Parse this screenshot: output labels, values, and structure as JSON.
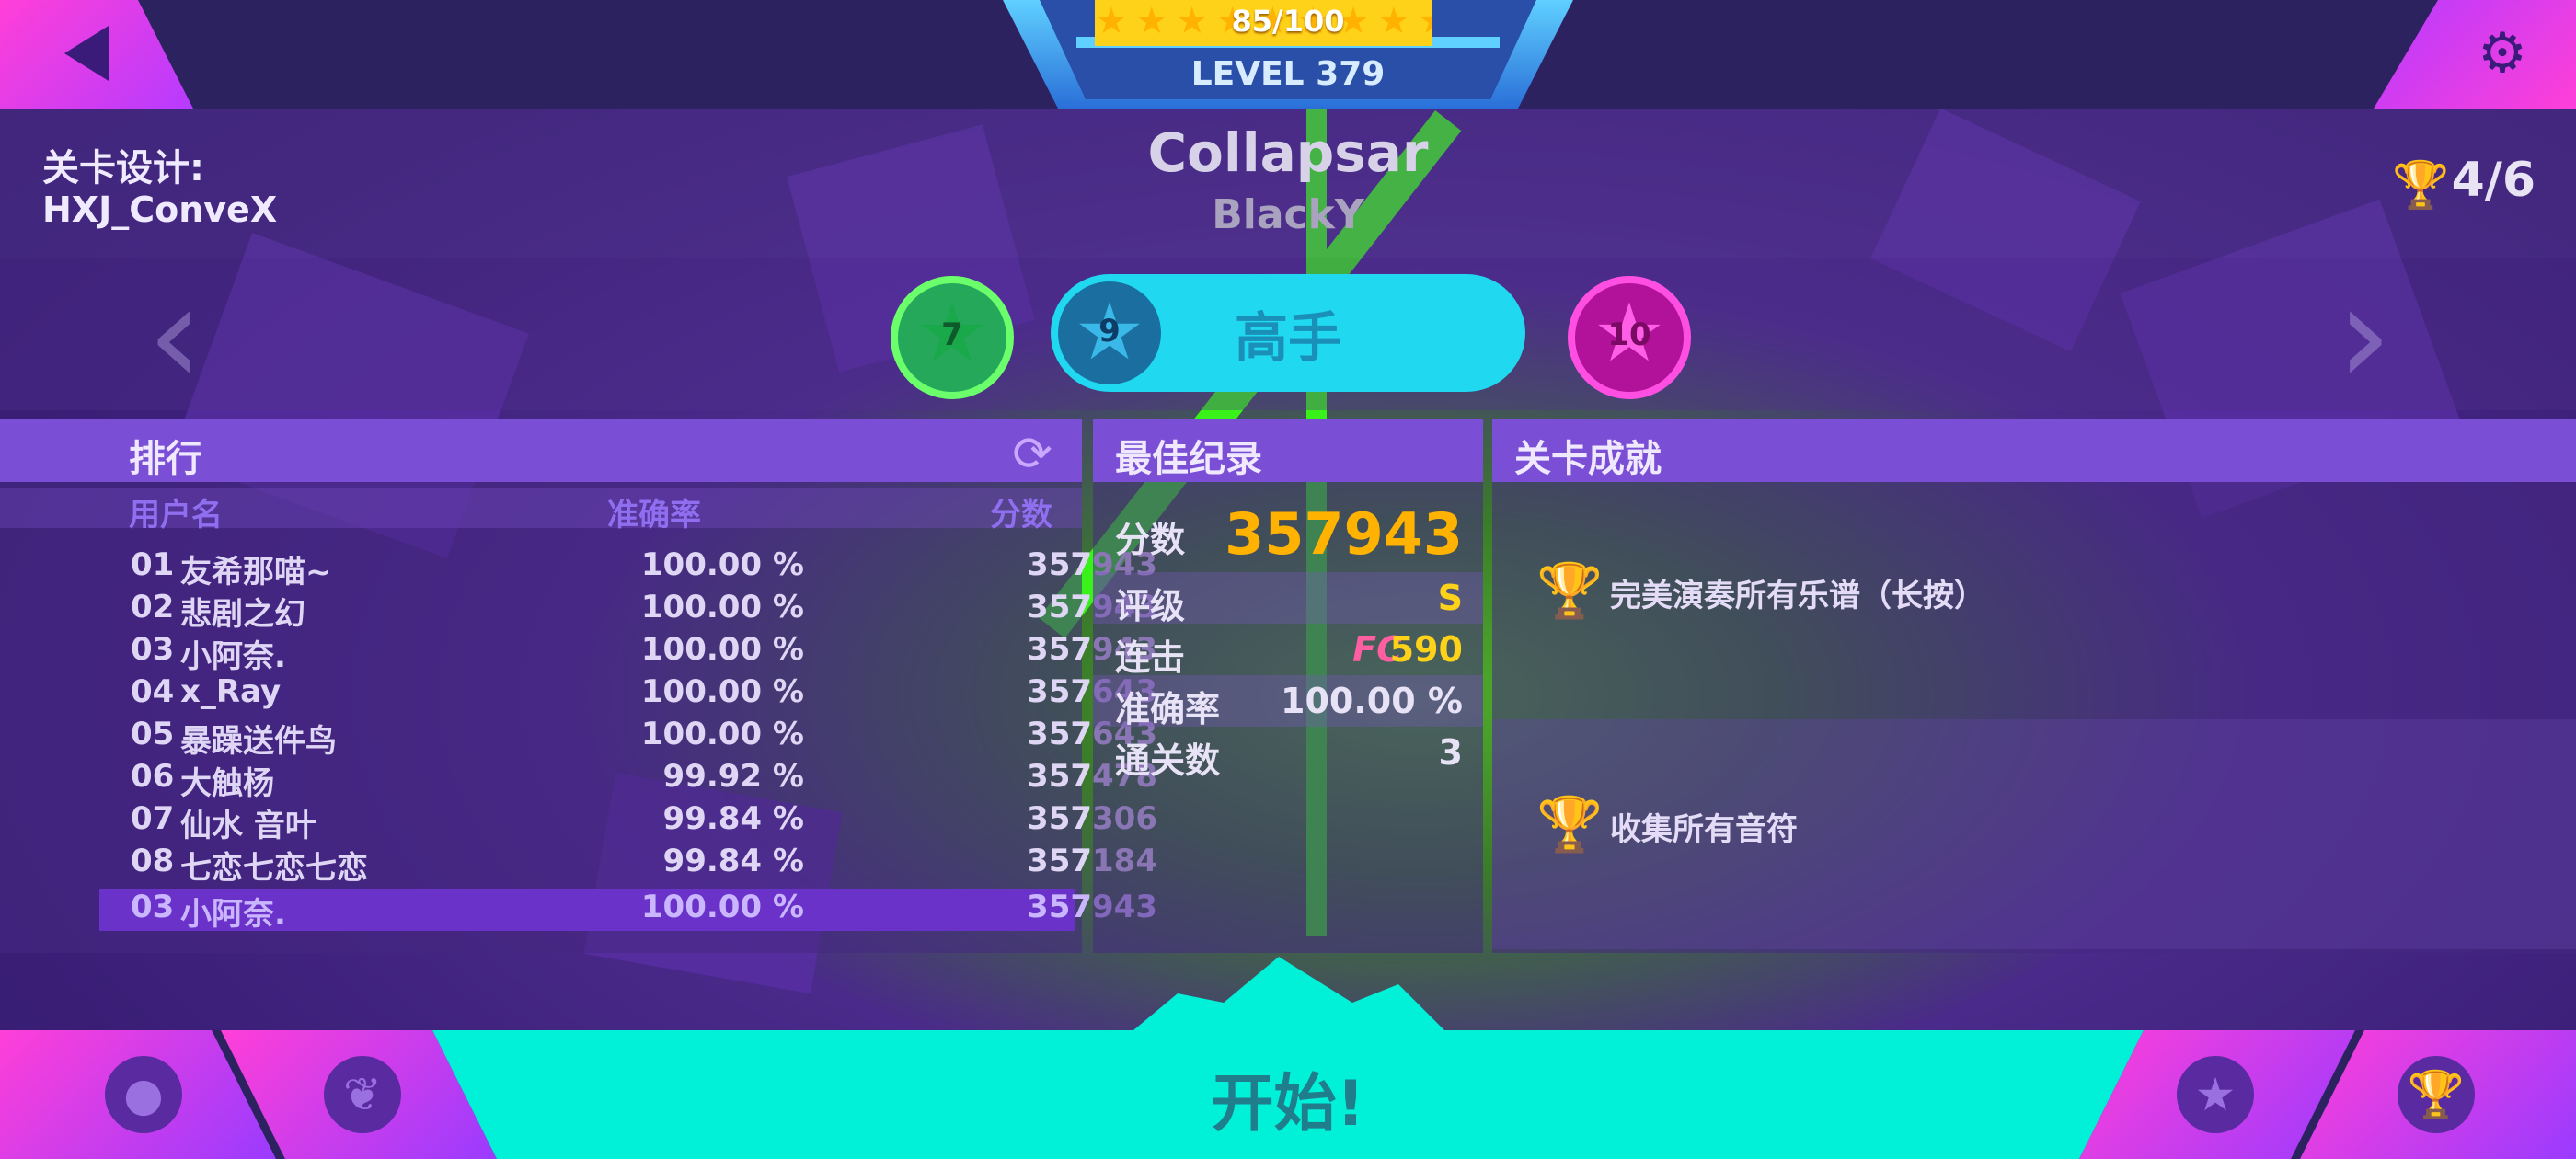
{
  "header": {
    "xp_progress_text": "85/100",
    "xp_progress": 0.85,
    "level_text": "LEVEL 379"
  },
  "song": {
    "designer_label": "关卡设计:",
    "designer_name": "HXJ_ConveX",
    "title": "Collapsar",
    "artist": "BlackY",
    "trophies": "4/6"
  },
  "difficulty": {
    "easy_level": "7",
    "selected_level": "9",
    "selected_label": "高手",
    "hard_level": "10"
  },
  "leaderboard": {
    "title": "排行",
    "columns": {
      "user": "用户名",
      "accuracy": "准确率",
      "score": "分数"
    },
    "rows": [
      {
        "rank": "01",
        "name": "友希那喵~",
        "accuracy": "100.00 %",
        "score": "357943"
      },
      {
        "rank": "02",
        "name": "悲剧之幻",
        "accuracy": "100.00 %",
        "score": "357943"
      },
      {
        "rank": "03",
        "name": "小阿奈.",
        "accuracy": "100.00 %",
        "score": "357943"
      },
      {
        "rank": "04",
        "name": "x_Ray",
        "accuracy": "100.00 %",
        "score": "357643"
      },
      {
        "rank": "05",
        "name": "暴躁送件鸟",
        "accuracy": "100.00 %",
        "score": "357643"
      },
      {
        "rank": "06",
        "name": "大触杨",
        "accuracy": "99.92 %",
        "score": "357478"
      },
      {
        "rank": "07",
        "name": "仙水 音叶",
        "accuracy": "99.84 %",
        "score": "357306"
      },
      {
        "rank": "08",
        "name": "七恋七恋七恋",
        "accuracy": "99.84 %",
        "score": "357184"
      }
    ],
    "me": {
      "rank": "03",
      "name": "小阿奈.",
      "accuracy": "100.00 %",
      "score": "357943"
    }
  },
  "best_record": {
    "title": "最佳纪录",
    "score_label": "分数",
    "score": "357943",
    "grade_label": "评级",
    "grade": "S",
    "combo_label": "连击",
    "combo_badge": "FC",
    "combo": "590",
    "accuracy_label": "准确率",
    "accuracy": "100.00 %",
    "clears_label": "通关数",
    "clears": "3"
  },
  "achievements": {
    "title": "关卡成就",
    "items": [
      "完美演奏所有乐谱（长按）",
      "收集所有音符"
    ]
  },
  "start_label": "开始!",
  "colors": {
    "accent_cyan": "#00f0d8",
    "accent_pink": "#ff3fd8",
    "gold": "#ffd21a",
    "panel_purple": "#7a4fd6"
  }
}
